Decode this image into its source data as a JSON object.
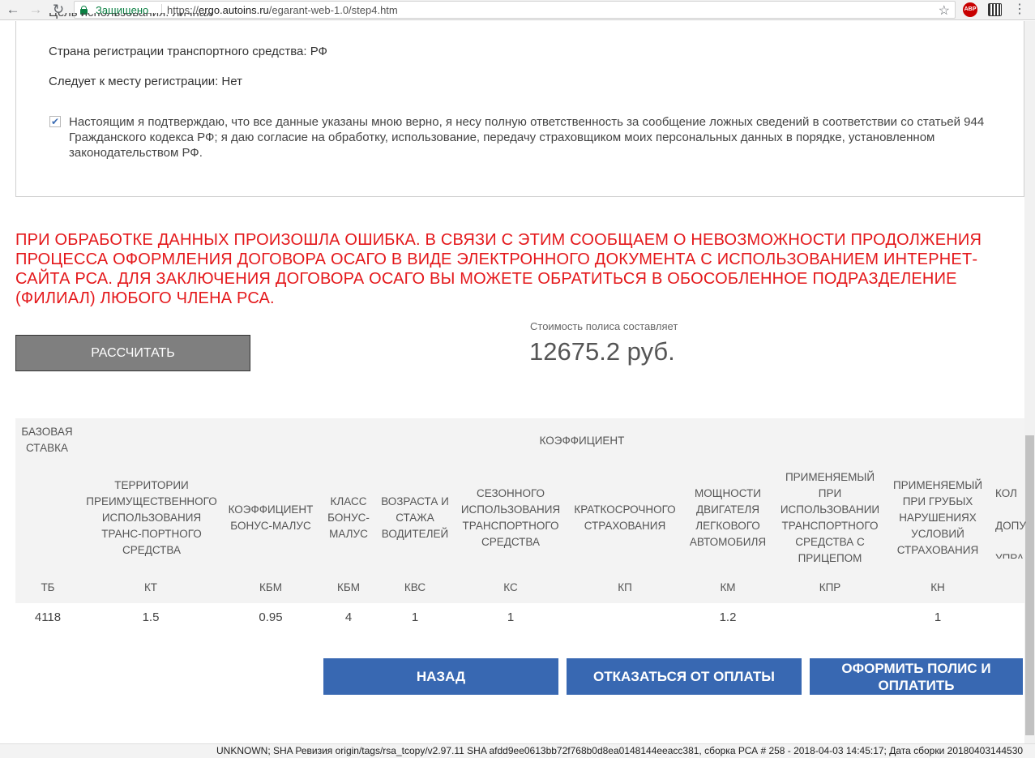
{
  "browser": {
    "secure_label": "Защищено",
    "url_scheme": "https://",
    "url_host": "ergo.autoins.ru",
    "url_path": "/egarant-web-1.0/step4.htm",
    "adblock_label": "ABP"
  },
  "form": {
    "truncated_line": "Цель использования: личная",
    "country_label": "Страна регистрации транспортного средства: РФ",
    "registration_label": "Следует к месту регистрации: Нет",
    "consent_checked": true,
    "consent_text": "Настоящим я подтверждаю, что все данные указаны мною верно, я несу полную ответственность за сообщение ложных сведений в соответствии со статьей 944 Гражданского кодекса РФ; я даю согласие на обработку, использование, передачу страховщиком моих персональных данных в порядке, установленном законодательством РФ."
  },
  "error_message": "ПРИ ОБРАБОТКЕ ДАННЫХ ПРОИЗОШЛА ОШИБКА. В СВЯЗИ С ЭТИМ СООБЩАЕМ О НЕВОЗМОЖНОСТИ ПРОДОЛЖЕНИЯ ПРОЦЕССА ОФОРМЛЕНИЯ ДОГОВОРА ОСАГО В ВИДЕ ЭЛЕКТРОННОГО ДОКУМЕНТА С ИСПОЛЬЗОВАНИЕМ ИНТЕРНЕТ-САЙТА РСА. ДЛЯ ЗАКЛЮЧЕНИЯ ДОГОВОРА ОСАГО ВЫ МОЖЕТЕ ОБРАТИТЬСЯ В ОБОСОБЛЕННОЕ ПОДРАЗДЕЛЕНИЕ (ФИЛИАЛ) ЛЮБОГО ЧЛЕНА РСА.",
  "calculate_button": "РАССЧИТАТЬ",
  "cost": {
    "label": "Стоимость полиса составляет",
    "value": "12675.2 руб."
  },
  "table": {
    "base_rate_header": "БАЗОВАЯ СТАВКА",
    "coefficient_header": "КОЭФФИЦИЕНТ",
    "columns": [
      {
        "name": "ТЕРРИТОРИИ ПРЕИМУЩЕСТВЕННОГО ИСПОЛЬЗОВАНИЯ ТРАНС-ПОРТНОГО СРЕДСТВА",
        "code": "КТ",
        "value": "1.5"
      },
      {
        "name": "КОЭФФИЦИЕНТ БОНУС-МАЛУС",
        "code": "КБМ",
        "value": "0.95"
      },
      {
        "name": "КЛАСС БОНУС-МАЛУС",
        "code": "КБМ",
        "value": "4"
      },
      {
        "name": "ВОЗРАСТА И СТАЖА ВОДИТЕЛЕЙ",
        "code": "КВС",
        "value": "1"
      },
      {
        "name": "СЕЗОННОГО ИСПОЛЬЗОВАНИЯ ТРАНСПОРТНОГО СРЕДСТВА",
        "code": "КС",
        "value": "1"
      },
      {
        "name": "КРАТКОСРОЧНОГО СТРАХОВАНИЯ",
        "code": "КП",
        "value": ""
      },
      {
        "name": "МОЩНОСТИ ДВИГАТЕЛЯ ЛЕГКОВОГО АВТОМОБИЛЯ",
        "code": "КМ",
        "value": "1.2"
      },
      {
        "name": "ПРИМЕНЯЕМЫЙ ПРИ ИСПОЛЬЗОВАНИИ ТРАНСПОРТНОГО СРЕДСТВА С ПРИЦЕПОМ",
        "code": "КПР",
        "value": ""
      },
      {
        "name": "ПРИМЕНЯЕМЫЙ ПРИ ГРУБЫХ НАРУШЕНИЯХ УСЛОВИЙ СТРАХОВАНИЯ",
        "code": "КН",
        "value": "1"
      },
      {
        "name": "КОЛ ДОПУ УПРА",
        "code": "",
        "value": ""
      }
    ],
    "base_code": "ТБ",
    "base_value": "4118"
  },
  "actions": {
    "back": "НАЗАД",
    "refuse": "ОТКАЗАТЬСЯ ОТ ОПЛАТЫ",
    "pay": "ОФОРМИТЬ ПОЛИС И ОПЛАТИТЬ"
  },
  "footer_text": "UNKNOWN; SHA Ревизия origin/tags/rsa_tcopy/v2.97.11 SHA afdd9ee0613bb72f768b0d8ea0148144eeacc381, сборка РСА # 258 - 2018-04-03 14:45:17; Дата сборки 20180403144530"
}
